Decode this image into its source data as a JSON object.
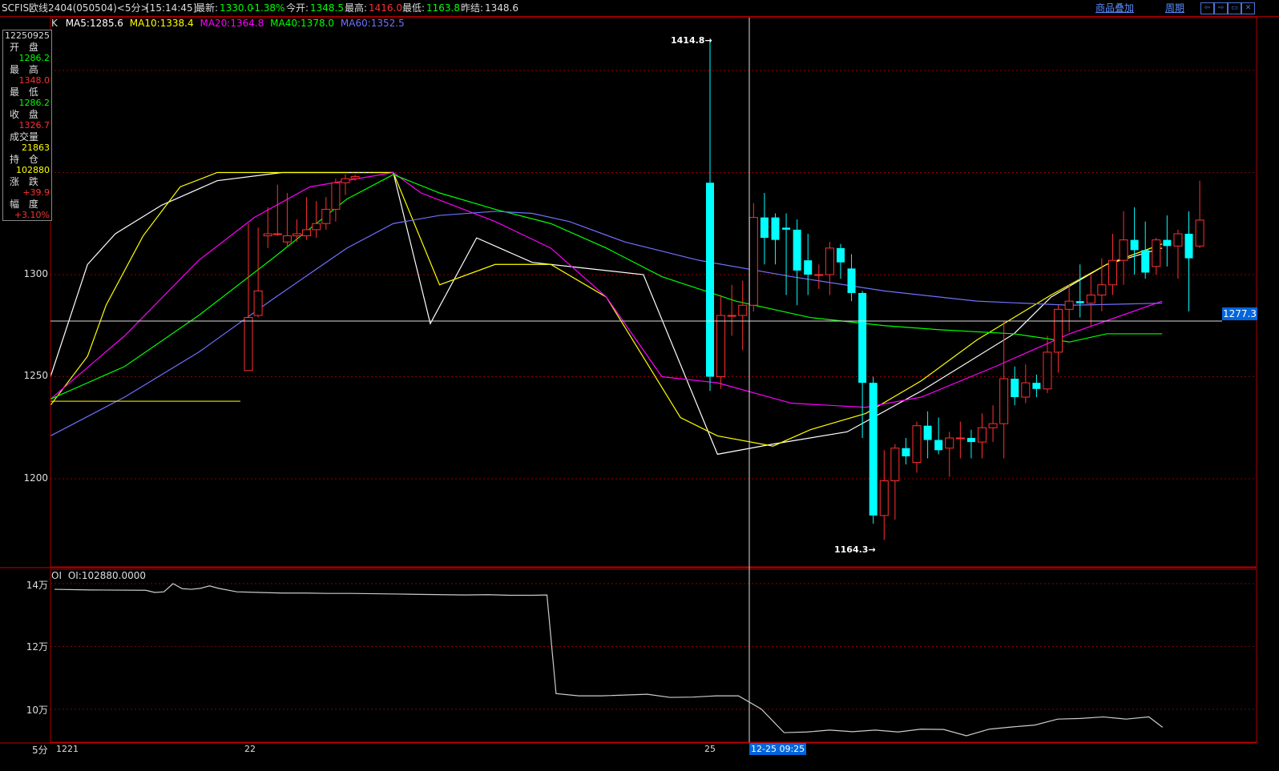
{
  "header": {
    "symbol": "SCFIS欧线2404(050504)<5分>",
    "time": "[15:14:45]",
    "latest_label": "最新:",
    "latest_value": "1330.0",
    "change": "-1.38%",
    "open_label": "今开:",
    "open_value": "1348.5",
    "high_label": "最高:",
    "high_value": "1416.0",
    "low_label": "最低:",
    "low_value": "1163.8",
    "prev_close_label": "昨结:",
    "prev_close_value": "1348.6",
    "overlay_link": "商品叠加",
    "period_link": "周期"
  },
  "ma_legend": {
    "prefix": "K",
    "ma5": "MA5:1285.6",
    "ma10": "MA10:1338.4",
    "ma20": "MA20:1364.8",
    "ma40": "MA40:1378.0",
    "ma60": "MA60:1352.5"
  },
  "info_panel": {
    "date": "12250925",
    "open_label": "开 盘",
    "open": "1286.2",
    "high_label": "最 高",
    "high": "1348.0",
    "low_label": "最 低",
    "low": "1286.2",
    "close_label": "收 盘",
    "close": "1326.7",
    "volume_label": "成交量",
    "volume": "21863",
    "oi_label": "持 仓",
    "oi": "102880",
    "change_label": "涨 跌",
    "change": "+39.9",
    "pct_label": "幅 度",
    "pct": "+3.10%"
  },
  "oi_panel": {
    "label": "OI",
    "value": "OI:102880.0000"
  },
  "footer": {
    "period": "5分",
    "crosshair_time": "12-25 09:25"
  },
  "annotations": {
    "max": "1414.8",
    "min": "1164.3",
    "crosshair_price": "1277.3"
  },
  "colors": {
    "up": "#ff3030",
    "down": "#00ffff",
    "ma5": "#ffffff",
    "ma10": "#ffff00",
    "ma20": "#ff00ff",
    "ma40": "#00ff00",
    "ma60": "#7070ff",
    "grid": "#8a0000",
    "oi_line": "#cccccc"
  },
  "chart_data": [
    {
      "type": "candlestick",
      "yticks": [
        1200,
        1250,
        1300
      ],
      "ylim": [
        1158,
        1430
      ],
      "xticks": [
        "1221",
        "22",
        "25"
      ],
      "candles": [
        [
          1253,
          1325,
          1261,
          1279,
          "22"
        ],
        [
          1280,
          1323,
          1279,
          1292,
          ""
        ],
        [
          1319,
          1333,
          1313,
          1320,
          ""
        ],
        [
          1320,
          1344,
          1319,
          1320,
          ""
        ],
        [
          1316,
          1340,
          1314,
          1319,
          ""
        ],
        [
          1319,
          1327,
          1316,
          1320,
          ""
        ],
        [
          1319,
          1338,
          1317,
          1322,
          ""
        ],
        [
          1322,
          1336,
          1318,
          1325,
          ""
        ],
        [
          1325,
          1338,
          1322,
          1332,
          ""
        ],
        [
          1332,
          1347,
          1326,
          1345,
          ""
        ],
        [
          1345,
          1349,
          1339,
          1347,
          ""
        ],
        [
          1347,
          1349,
          1346,
          1348,
          ""
        ],
        [
          1345,
          1414.8,
          1243,
          1250,
          "25"
        ],
        [
          1250,
          1290,
          1244,
          1280,
          ""
        ],
        [
          1280,
          1295,
          1270,
          1280,
          ""
        ],
        [
          1280,
          1297,
          1263,
          1285,
          ""
        ],
        [
          1285,
          1335,
          1282,
          1328,
          ""
        ],
        [
          1328,
          1340,
          1305,
          1318,
          ""
        ],
        [
          1328,
          1330,
          1305,
          1317,
          ""
        ],
        [
          1323,
          1330,
          1290,
          1322,
          ""
        ],
        [
          1322,
          1327,
          1285,
          1302,
          ""
        ],
        [
          1307,
          1320,
          1290,
          1300,
          ""
        ],
        [
          1300,
          1305,
          1293,
          1300,
          ""
        ],
        [
          1300,
          1316,
          1290,
          1313,
          ""
        ],
        [
          1313,
          1315,
          1298,
          1306,
          ""
        ],
        [
          1303,
          1310,
          1287,
          1291,
          ""
        ],
        [
          1291,
          1292,
          1220,
          1247,
          ""
        ],
        [
          1247,
          1250,
          1178,
          1182,
          ""
        ],
        [
          1182,
          1214,
          1170,
          1199,
          ""
        ],
        [
          1199,
          1217,
          1180,
          1215,
          ""
        ],
        [
          1215,
          1220,
          1207,
          1211,
          ""
        ],
        [
          1208,
          1228,
          1203,
          1226,
          ""
        ],
        [
          1226,
          1233,
          1210,
          1219,
          ""
        ],
        [
          1219,
          1230,
          1212,
          1214,
          ""
        ],
        [
          1215,
          1223,
          1201,
          1220,
          ""
        ],
        [
          1220,
          1228,
          1210,
          1220,
          ""
        ],
        [
          1220,
          1224,
          1210,
          1218,
          ""
        ],
        [
          1218,
          1232,
          1210,
          1225,
          ""
        ],
        [
          1225,
          1236,
          1218,
          1227,
          ""
        ],
        [
          1227,
          1277,
          1210,
          1249,
          ""
        ],
        [
          1249,
          1255,
          1236,
          1240,
          ""
        ],
        [
          1240,
          1256,
          1237,
          1247,
          ""
        ],
        [
          1247,
          1251,
          1240,
          1244,
          ""
        ],
        [
          1244,
          1270,
          1242,
          1262,
          ""
        ],
        [
          1262,
          1285,
          1252,
          1283,
          ""
        ],
        [
          1283,
          1295,
          1272,
          1287,
          ""
        ],
        [
          1287,
          1305,
          1279,
          1286,
          ""
        ],
        [
          1286,
          1300,
          1275,
          1290,
          ""
        ],
        [
          1290,
          1308,
          1282,
          1295,
          ""
        ],
        [
          1295,
          1320,
          1290,
          1307,
          ""
        ],
        [
          1307,
          1331,
          1295,
          1317,
          ""
        ],
        [
          1317,
          1333,
          1300,
          1312,
          ""
        ],
        [
          1312,
          1326,
          1298,
          1301,
          ""
        ],
        [
          1304,
          1318,
          1300,
          1317,
          ""
        ],
        [
          1317,
          1329,
          1304,
          1314,
          ""
        ],
        [
          1314,
          1322,
          1298,
          1320,
          ""
        ],
        [
          1320,
          1331,
          1282,
          1308,
          ""
        ],
        [
          1314,
          1346,
          1313,
          1326.7,
          ""
        ]
      ],
      "ma_series": [
        {
          "name": "MA5",
          "x": [
            0,
            2,
            3.5,
            6,
            9,
            12.5,
            18.5,
            20.5,
            23,
            26,
            29,
            32,
            36,
            39,
            43,
            47,
            52,
            54,
            57,
            60
          ],
          "values": [
            1250,
            1305,
            1320,
            1334,
            1346,
            1350,
            1350,
            1276,
            1318,
            1306,
            1303,
            1300,
            1212,
            1217,
            1223,
            1243,
            1271,
            1289,
            1305,
            1313
          ]
        },
        {
          "name": "MA10",
          "x": [
            0,
            2,
            3,
            5,
            7,
            9,
            12.5,
            18.5,
            21,
            24,
            27,
            30,
            34,
            36,
            39,
            41,
            44,
            47,
            50,
            54,
            57,
            60
          ],
          "values": [
            1236,
            1260,
            1285,
            1319,
            1343,
            1350,
            1350,
            1350,
            1295,
            1305,
            1305,
            1289,
            1230,
            1221,
            1216,
            1224,
            1232,
            1248,
            1268,
            1290,
            1305,
            1315
          ]
        },
        {
          "name": "MA20",
          "x": [
            0,
            4,
            8,
            11,
            14,
            18.5,
            20,
            24,
            27,
            30,
            33,
            36,
            40,
            44,
            47,
            51,
            55,
            60
          ],
          "values": [
            1239,
            1270,
            1307,
            1328,
            1343,
            1350,
            1340,
            1326,
            1313,
            1289,
            1250,
            1247,
            1237,
            1235,
            1240,
            1255,
            1271,
            1287
          ]
        },
        {
          "name": "MA40",
          "x": [
            0,
            4,
            8,
            12,
            16,
            18.5,
            21,
            24,
            27,
            30,
            33,
            37,
            41,
            45,
            48,
            52,
            55,
            57,
            60
          ],
          "values": [
            1239,
            1255,
            1280,
            1308,
            1337,
            1349,
            1340,
            1332,
            1325,
            1313,
            1299,
            1287,
            1279,
            1275,
            1273,
            1271,
            1267,
            1271,
            1271
          ]
        },
        {
          "name": "MA60",
          "x": [
            0,
            4,
            8,
            12,
            16,
            18.5,
            21,
            24,
            26,
            28,
            31,
            35,
            40,
            45,
            50,
            55,
            60
          ],
          "values": [
            1221,
            1240,
            1262,
            1288,
            1313,
            1325,
            1329,
            1331,
            1330,
            1326,
            1316,
            1307,
            1299,
            1292,
            1287,
            1285,
            1286
          ]
        }
      ]
    },
    {
      "type": "line",
      "series_name": "OI",
      "yticks_label": [
        "14万",
        "12万",
        "10万"
      ],
      "yticks": [
        140000,
        120000,
        100000
      ],
      "ylim": [
        89000,
        145000
      ],
      "x": [
        0,
        8,
        20,
        22,
        24,
        26,
        28,
        30,
        32,
        34,
        36,
        40,
        45,
        50,
        55,
        60,
        65,
        70,
        75,
        80,
        85,
        90,
        95,
        100,
        105,
        108,
        110,
        115,
        120,
        130,
        135,
        140,
        145,
        150,
        155,
        160,
        165,
        170,
        175,
        180,
        185,
        190,
        195,
        200,
        205,
        210,
        215,
        220,
        225,
        230,
        235,
        240,
        243
      ],
      "values": [
        138200,
        138000,
        137900,
        137200,
        137400,
        140000,
        138400,
        138200,
        138500,
        139300,
        138500,
        137400,
        137200,
        137000,
        137000,
        136900,
        136900,
        136800,
        136700,
        136600,
        136500,
        136400,
        136500,
        136300,
        136300,
        136400,
        105000,
        104300,
        104300,
        104800,
        103800,
        103900,
        104300,
        104300,
        100100,
        92600,
        92800,
        93400,
        92900,
        93400,
        92800,
        93700,
        93600,
        91600,
        93700,
        94400,
        95000,
        96900,
        97100,
        97600,
        96900,
        97600,
        94300
      ]
    }
  ]
}
